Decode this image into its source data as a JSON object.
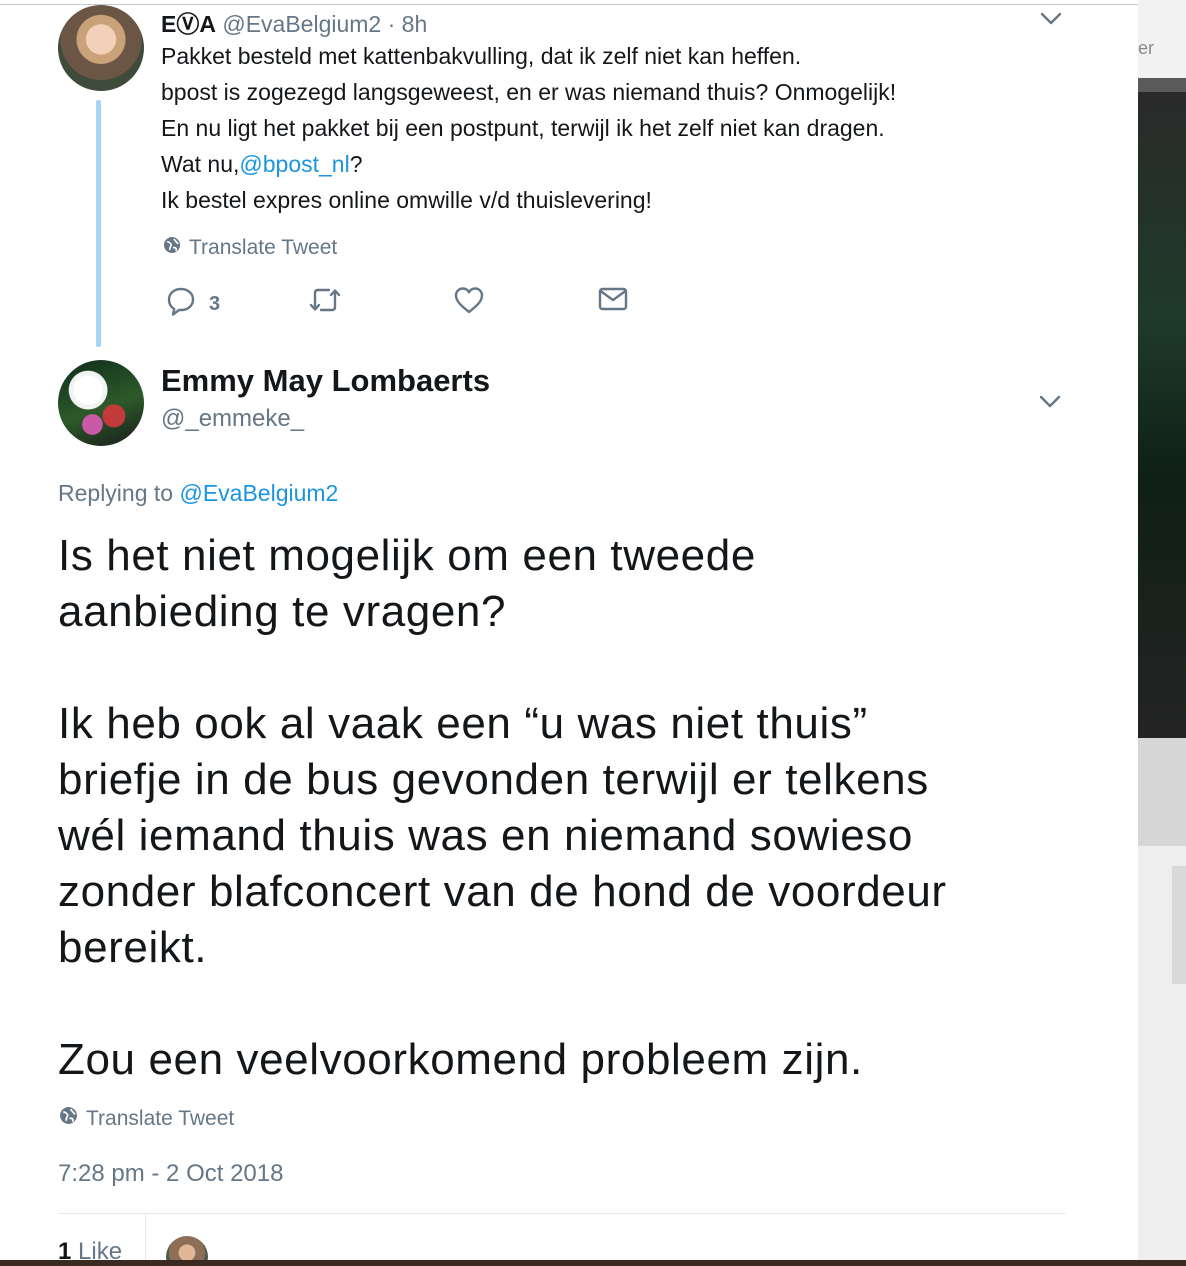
{
  "backdrop": {
    "partial_text": "er"
  },
  "original_tweet": {
    "display_name": "EⓋA",
    "handle": "@EvaBelgium2",
    "separator": "·",
    "age": "8h",
    "lines": [
      "Pakket besteld met kattenbakvulling, dat ik zelf niet kan heffen.",
      "bpost is zogezegd langsgeweest, en er was niemand thuis? Onmogelijk!",
      "En nu ligt het pakket bij een postpunt, terwijl ik het zelf niet kan dragen."
    ],
    "mention_prefix": "Wat nu,",
    "mention": "@bpost_nl",
    "mention_suffix": "?",
    "last_line": "Ik bestel expres online omwille v/d thuislevering!",
    "translate_label": "Translate Tweet",
    "reply_count": "3",
    "icons": [
      "reply-icon",
      "retweet-icon",
      "like-icon",
      "message-icon",
      "globe-icon",
      "chevron-down-icon"
    ]
  },
  "reply_tweet": {
    "display_name": "Emmy May Lombaerts",
    "handle": "@_emmeke_",
    "replying_prefix": "Replying to",
    "replying_to": "@EvaBelgium2",
    "paragraph1": [
      "Is het niet mogelijk om een tweede",
      "aanbieding te vragen?"
    ],
    "paragraph2": [
      "Ik heb ook al vaak een “u was niet thuis”",
      "briefje in de bus gevonden terwijl er telkens",
      "wél iemand thuis was en niemand sowieso",
      "zonder blafconcert van de hond de voordeur",
      "bereikt."
    ],
    "paragraph3": [
      "Zou een veelvoorkomend probleem zijn."
    ],
    "translate_label": "Translate Tweet",
    "timestamp": "7:28 pm - 2 Oct 2018",
    "like_count": "1",
    "like_label": "Like"
  },
  "colors": {
    "link": "#1b95e0",
    "muted": "#657786",
    "thread_line": "#a6d6f7",
    "text": "#14171a"
  }
}
